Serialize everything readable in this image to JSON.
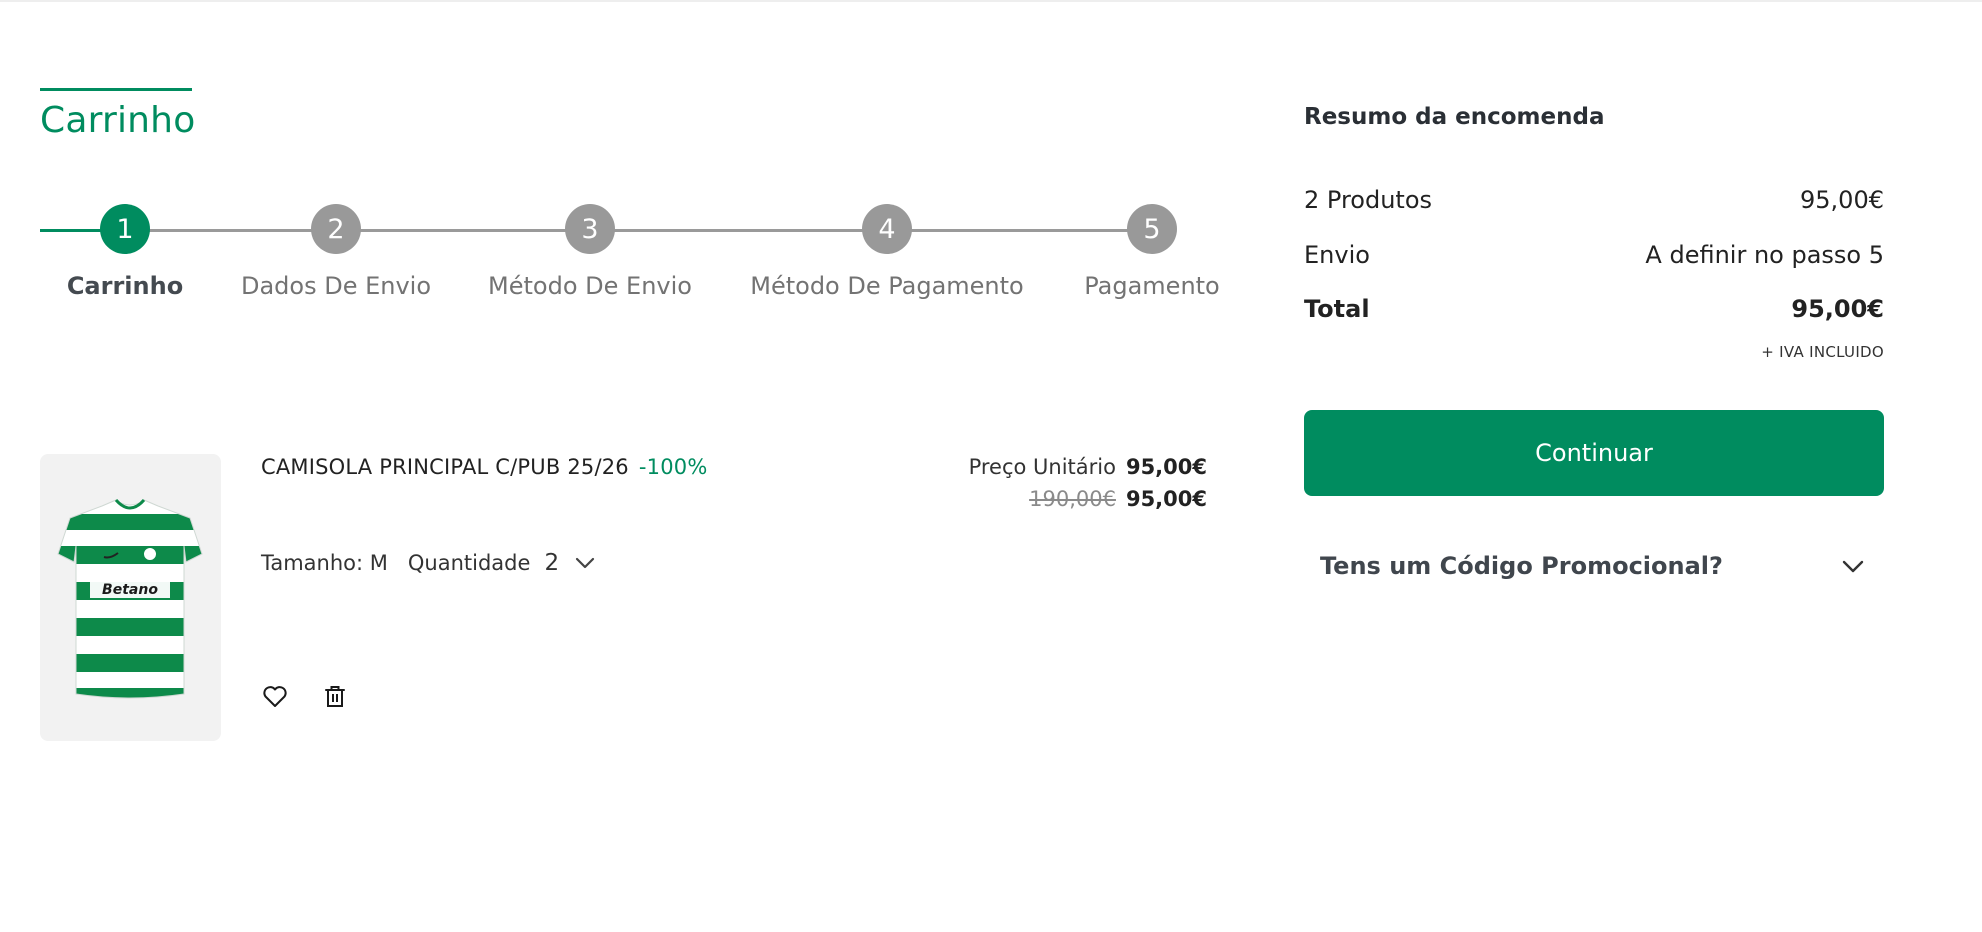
{
  "page": {
    "title": "Carrinho"
  },
  "stepper": {
    "steps": [
      {
        "number": "1",
        "label": "Carrinho",
        "active": true
      },
      {
        "number": "2",
        "label": "Dados De Envio",
        "active": false
      },
      {
        "number": "3",
        "label": "Método De Envio",
        "active": false
      },
      {
        "number": "4",
        "label": "Método De Pagamento",
        "active": false
      },
      {
        "number": "5",
        "label": "Pagamento",
        "active": false
      }
    ]
  },
  "product": {
    "name": "CAMISOLA PRINCIPAL C/PUB 25/26",
    "discount": "-100%",
    "unit_price_label": "Preço Unitário",
    "unit_price": "95,00€",
    "old_price": "190,00€",
    "new_price": "95,00€",
    "size_label": "Tamanho: M",
    "quantity_label": "Quantidade",
    "quantity_value": "2",
    "image_brand_text": "Betano",
    "image_icon": "jersey-image",
    "actions": {
      "wishlist_icon": "heart-icon",
      "delete_icon": "trash-icon"
    }
  },
  "summary": {
    "title": "Resumo da encomenda",
    "products_label": "2 Produtos",
    "products_value": "95,00€",
    "shipping_label": "Envio",
    "shipping_value": "A definir no passo 5",
    "total_label": "Total",
    "total_value": "95,00€",
    "tax_note": "+ IVA INCLUIDO",
    "continue_label": "Continuar",
    "promo_label": "Tens um Código Promocional?"
  },
  "colors": {
    "accent": "#008c5f",
    "step_inactive": "#999999",
    "text": "#222222"
  }
}
